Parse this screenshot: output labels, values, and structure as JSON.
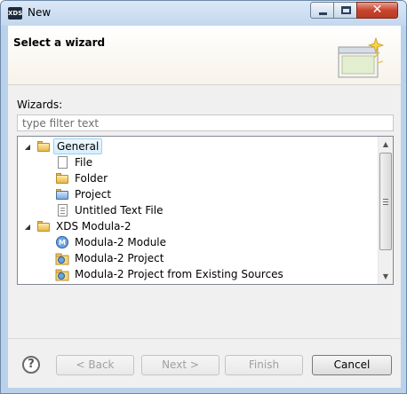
{
  "window": {
    "app_icon": "XDS",
    "title": "New",
    "controls": {
      "minimize": "minimize-icon",
      "maximize": "maximize-icon",
      "close": "close-icon"
    }
  },
  "banner": {
    "title": "Select a wizard",
    "graphic": "wizard-sparkle-icon"
  },
  "wizards": {
    "label": "Wizards:",
    "filter_placeholder": "type filter text",
    "filter_value": ""
  },
  "tree": {
    "items": [
      {
        "label": "General",
        "icon": "folder-open-icon",
        "expanded": true,
        "selected": true,
        "level": 0
      },
      {
        "label": "File",
        "icon": "file-icon",
        "level": 1
      },
      {
        "label": "Folder",
        "icon": "folder-icon",
        "level": 1
      },
      {
        "label": "Project",
        "icon": "project-folder-icon",
        "level": 1
      },
      {
        "label": "Untitled Text File",
        "icon": "text-file-icon",
        "level": 1
      },
      {
        "label": "XDS Modula-2",
        "icon": "folder-open-icon",
        "expanded": true,
        "level": 0
      },
      {
        "label": "Modula-2 Module",
        "icon": "modula-module-icon",
        "level": 1
      },
      {
        "label": "Modula-2 Project",
        "icon": "modula-project-icon",
        "level": 1
      },
      {
        "label": "Modula-2 Project from Existing Sources",
        "icon": "modula-project-icon",
        "level": 1
      }
    ]
  },
  "buttons": {
    "help": "?",
    "back": "< Back",
    "next": "Next >",
    "finish": "Finish",
    "cancel": "Cancel"
  },
  "colors": {
    "title_bar": "#c3d7ee",
    "selection": "#d5effc",
    "close_button": "#c7442f"
  }
}
